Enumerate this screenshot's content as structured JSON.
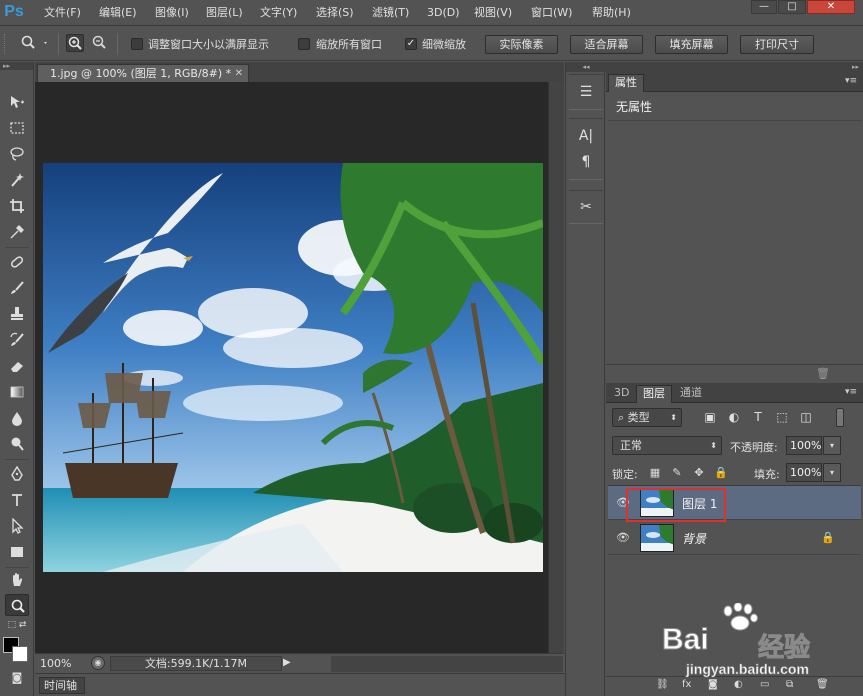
{
  "app": {
    "logo": "Ps"
  },
  "menu": [
    "文件(F)",
    "编辑(E)",
    "图像(I)",
    "图层(L)",
    "文字(Y)",
    "选择(S)",
    "滤镜(T)",
    "3D(D)",
    "视图(V)",
    "窗口(W)",
    "帮助(H)"
  ],
  "window_controls": {
    "minimize": "—",
    "maximize": "□",
    "close": "✕"
  },
  "options": {
    "resize_windows_label": "调整窗口大小以满屏显示",
    "resize_windows_checked": false,
    "zoom_all_label": "缩放所有窗口",
    "zoom_all_checked": false,
    "scrubby_zoom_label": "细微缩放",
    "scrubby_zoom_checked": true,
    "actual_pixels": "实际像素",
    "fit_screen": "适合屏幕",
    "fill_screen": "填充屏幕",
    "print_size": "打印尺寸"
  },
  "document": {
    "tab_title": "1.jpg @ 100% (图层 1, RGB/8#) *",
    "zoom": "100%",
    "doc_info": "文档:599.1K/1.17M"
  },
  "timeline": {
    "label": "时间轴"
  },
  "properties": {
    "tab_label": "属性",
    "empty_label": "无属性"
  },
  "layers_panel": {
    "tabs": [
      "3D",
      "图层",
      "通道"
    ],
    "active_tab": "图层",
    "filter_kind": "类型",
    "blend_mode": "正常",
    "opacity_label": "不透明度:",
    "opacity": "100%",
    "lock_label": "锁定:",
    "fill_label": "填充:",
    "fill": "100%",
    "layers": [
      {
        "name": "图层 1",
        "selected": true,
        "visible": true,
        "locked": false
      },
      {
        "name": "背景",
        "selected": false,
        "visible": true,
        "locked": true
      }
    ],
    "footer_fx": "fx"
  },
  "watermark": {
    "brand_left": "Bai",
    "brand_right": "经验",
    "url": "jingyan.baidu.com"
  },
  "colors": {
    "accent_selection": "#5d6b82",
    "highlight": "#e0302b",
    "ps_blue": "#3a9bdc"
  }
}
